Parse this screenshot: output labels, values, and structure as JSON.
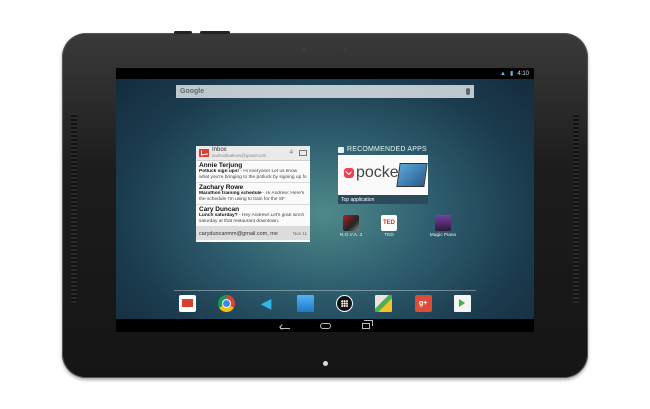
{
  "statusbar": {
    "time": "4:10"
  },
  "search": {
    "label": "Google"
  },
  "gmail_widget": {
    "title": "Inbox",
    "account": "androidnatives@gmail.com",
    "count": "4",
    "messages": [
      {
        "from": "Annie Terjung",
        "subject": "Potluck sign ups!",
        "snippet": " - Hi everyone! Let us know what you're bringing to the potluck by signing up fo"
      },
      {
        "from": "Zachary Rowe",
        "subject": "Marathon training schedule",
        "snippet": " - Hi Andrew: Here's the schedule I'm using to train for the SF Marathon. Good"
      },
      {
        "from": "Cary Duncan",
        "subject": "Lunch saturday?",
        "snippet": " - Hey Andrew! Let's grab lunch saturday at that restaurant downtown."
      }
    ],
    "footer": {
      "from": "caryduncanmm@gmail.com, me",
      "date": "Nov 11"
    }
  },
  "recommended": {
    "title": "RECOMMENDED APPS",
    "featured": {
      "name": "pocket",
      "caption": "Top application"
    },
    "apps": [
      {
        "label": "N.O.V.A. 3"
      },
      {
        "label": "TED"
      },
      {
        "label": "Magic Piano"
      }
    ]
  },
  "ted_icon_text": "TED",
  "dock": {
    "gplus_text": "g+"
  }
}
